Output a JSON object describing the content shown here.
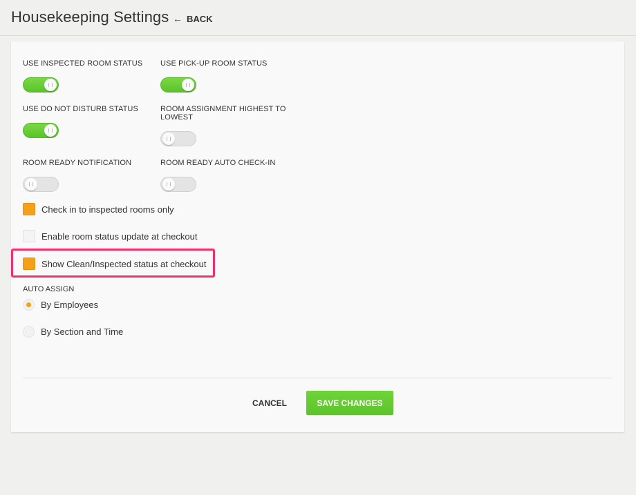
{
  "header": {
    "title": "Housekeeping Settings",
    "back_label": "BACK"
  },
  "toggles": [
    {
      "label": "USE INSPECTED ROOM STATUS",
      "on": true
    },
    {
      "label": "USE PICK-UP ROOM STATUS",
      "on": true
    },
    {
      "label": "USE DO NOT DISTURB STATUS",
      "on": true
    },
    {
      "label": "ROOM ASSIGNMENT HIGHEST TO",
      "label_line2": "LOWEST",
      "on": false
    },
    {
      "label": "ROOM READY NOTIFICATION",
      "on": false
    },
    {
      "label": "ROOM READY AUTO CHECK-IN",
      "on": false
    }
  ],
  "checkboxes": [
    {
      "label": "Check in to inspected rooms only",
      "checked": true
    },
    {
      "label": "Enable room status update at checkout",
      "checked": false
    },
    {
      "label": "Show Clean/Inspected status at checkout",
      "checked": true
    }
  ],
  "auto_assign": {
    "label": "AUTO ASSIGN",
    "options": [
      {
        "label": "By Employees",
        "selected": true
      },
      {
        "label": "By Section and Time",
        "selected": false
      }
    ]
  },
  "actions": {
    "cancel_label": "CANCEL",
    "save_label": "SAVE CHANGES"
  },
  "colors": {
    "toggle_on": "#5ac32a",
    "checkbox_checked": "#f5a01a",
    "highlight": "#f22f6c",
    "save_button": "#66cc33"
  }
}
